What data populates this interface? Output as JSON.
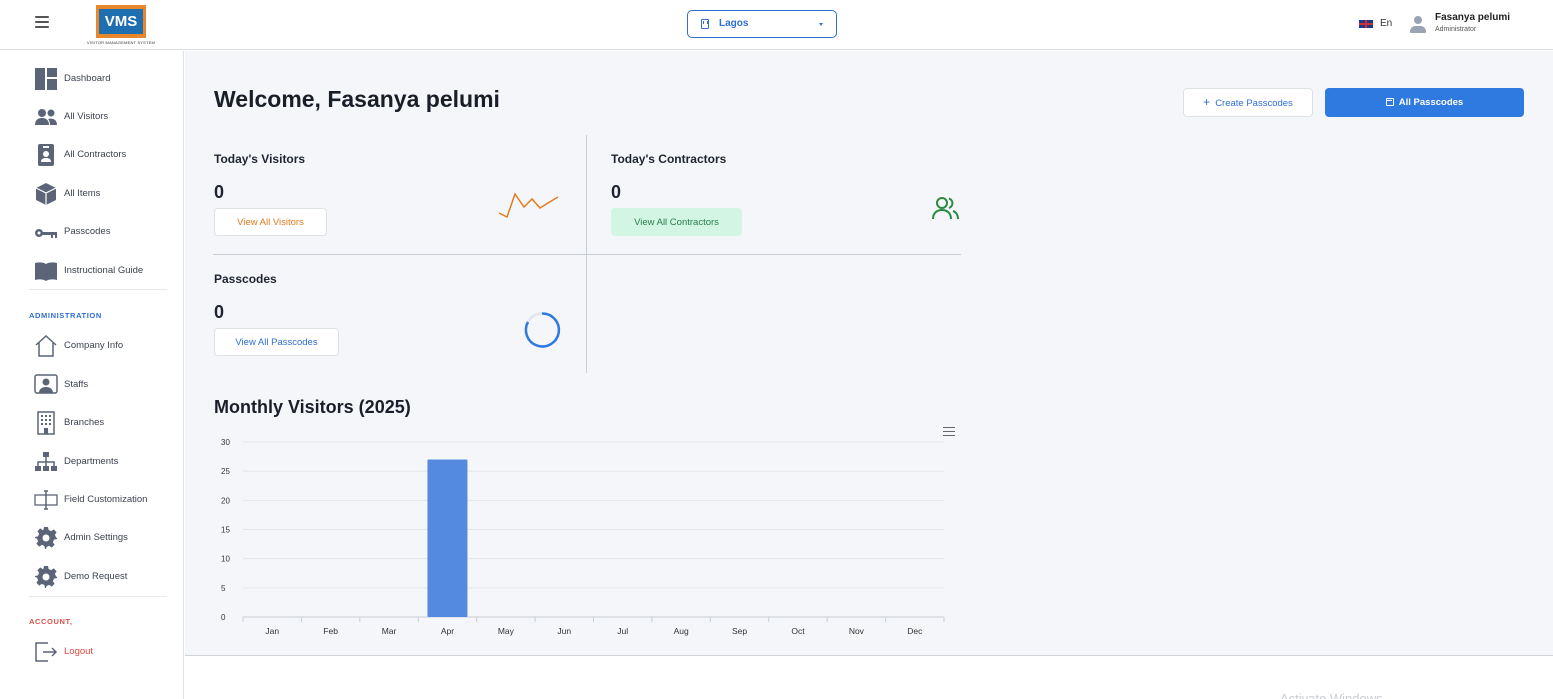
{
  "header": {
    "logo_text": "VMS",
    "logo_subtitle": "VISITOR MANAGEMENT SYSTEM",
    "branch": "Lagos",
    "language": "En",
    "user_name": "Fasanya pelumi",
    "user_role": "Administrator"
  },
  "sidebar": {
    "items": [
      {
        "label": "Dashboard",
        "icon": "dashboard-icon"
      },
      {
        "label": "All Visitors",
        "icon": "users-icon"
      },
      {
        "label": "All Contractors",
        "icon": "id-badge-icon"
      },
      {
        "label": "All Items",
        "icon": "box-icon"
      },
      {
        "label": "Passcodes",
        "icon": "key-icon"
      },
      {
        "label": "Instructional Guide",
        "icon": "book-icon"
      }
    ],
    "admin_title": "ADMINISTRATION",
    "admin_items": [
      {
        "label": "Company Info",
        "icon": "home-icon"
      },
      {
        "label": "Staffs",
        "icon": "staff-icon"
      },
      {
        "label": "Branches",
        "icon": "building-icon"
      },
      {
        "label": "Departments",
        "icon": "org-chart-icon"
      },
      {
        "label": "Field Customization",
        "icon": "text-cursor-icon"
      },
      {
        "label": "Admin Settings",
        "icon": "gear-icon"
      },
      {
        "label": "Demo Request",
        "icon": "gear-icon"
      }
    ],
    "account_title": "ACCOUNT,",
    "logout": "Logout"
  },
  "main": {
    "welcome": "Welcome, Fasanya pelumi",
    "create_passcodes": "Create Passcodes",
    "all_passcodes": "All Passcodes",
    "cards": {
      "visitors": {
        "title": "Today's Visitors",
        "count": "0",
        "button": "View All Visitors"
      },
      "contractors": {
        "title": "Today's Contractors",
        "count": "0",
        "button": "View All Contractors"
      },
      "passcodes": {
        "title": "Passcodes",
        "count": "0",
        "button": "View All Passcodes"
      }
    },
    "chart_title": "Monthly Visitors (2025)"
  },
  "colors": {
    "primary": "#2f7ae0",
    "bar": "#548be0",
    "orange": "#e37b1d",
    "green": "#2a8a3e",
    "admin_title": "#2f6fd6",
    "account_title": "#d9534f"
  },
  "chart_data": {
    "type": "bar",
    "categories": [
      "Jan",
      "Feb",
      "Mar",
      "Apr",
      "May",
      "Jun",
      "Jul",
      "Aug",
      "Sep",
      "Oct",
      "Nov",
      "Dec"
    ],
    "values": [
      0,
      0,
      0,
      27,
      0,
      0,
      0,
      0,
      0,
      0,
      0,
      0
    ],
    "ylim": [
      0,
      30
    ],
    "yticks": [
      0,
      5,
      10,
      15,
      20,
      25,
      30
    ],
    "title": "Monthly Visitors (2025)",
    "xlabel": "",
    "ylabel": "",
    "grid": true
  }
}
